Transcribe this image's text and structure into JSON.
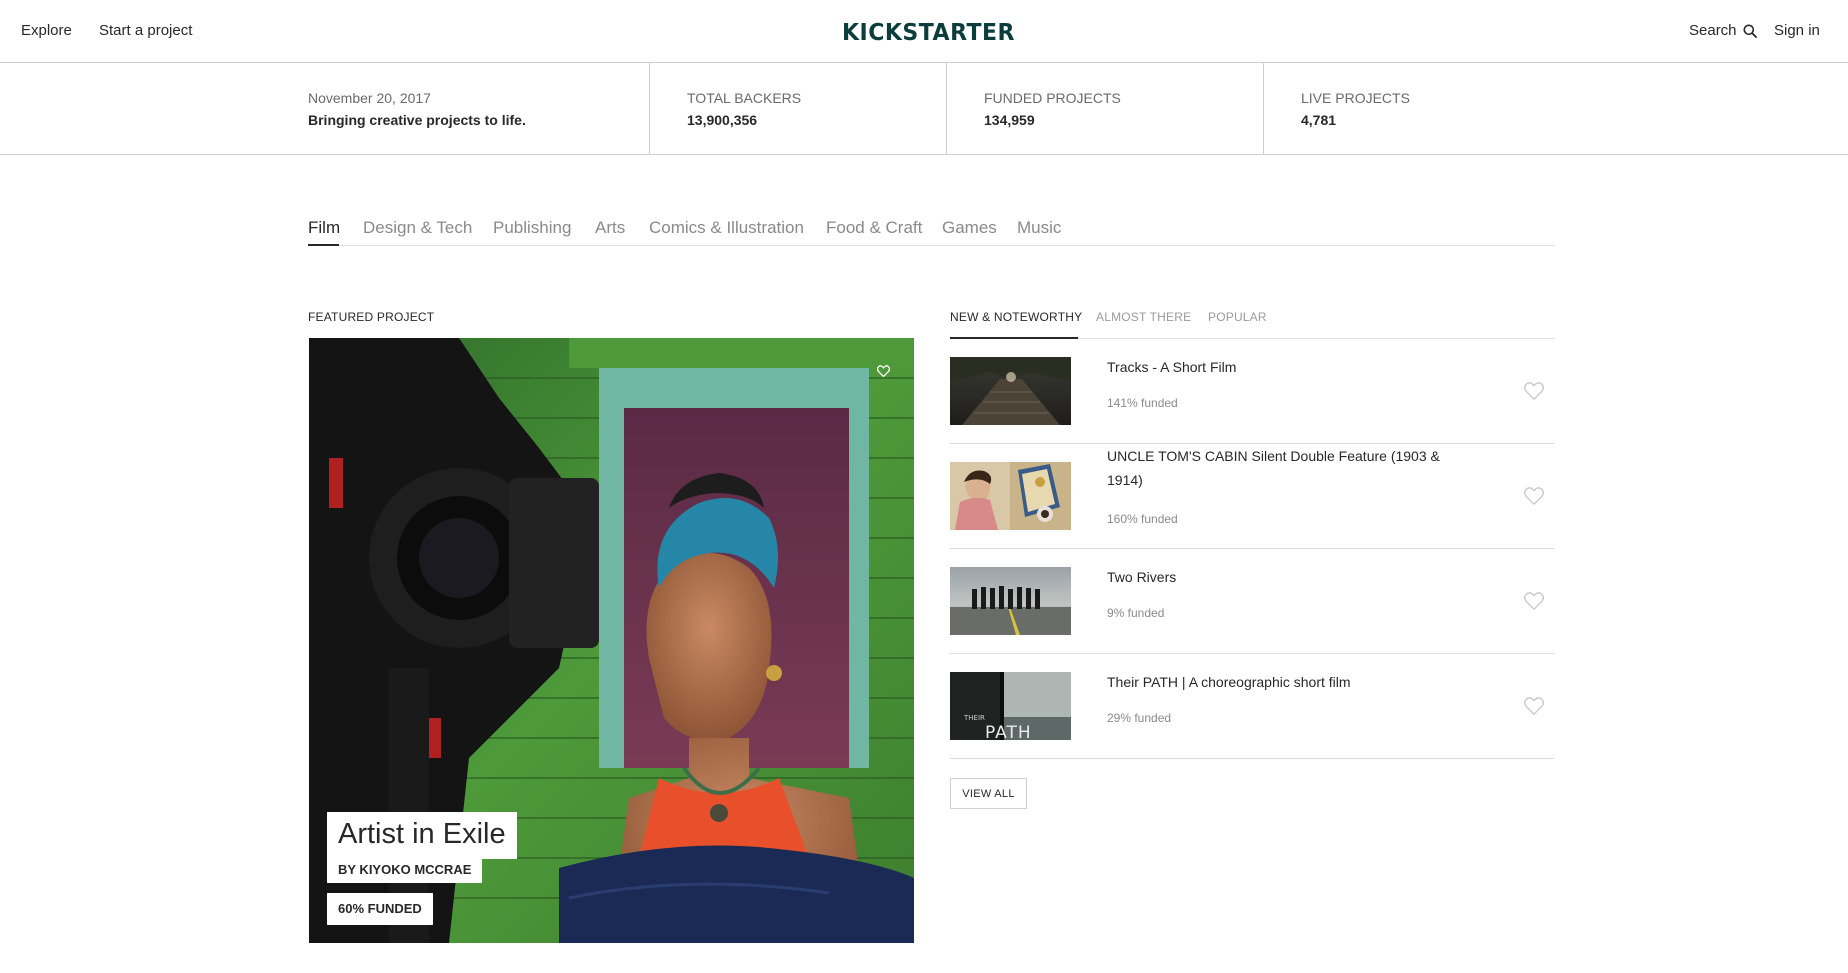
{
  "nav": {
    "explore": "Explore",
    "start_project": "Start a project",
    "logo_text": "KICKSTARTER",
    "search": "Search",
    "sign_in": "Sign in"
  },
  "stats": {
    "date": "November 20, 2017",
    "tagline": "Bringing creative projects to life.",
    "backers_label": "TOTAL BACKERS",
    "backers_value": "13,900,356",
    "funded_label": "FUNDED PROJECTS",
    "funded_value": "134,959",
    "live_label": "LIVE PROJECTS",
    "live_value": "4,781"
  },
  "categories": [
    "Film",
    "Design & Tech",
    "Publishing",
    "Arts",
    "Comics & Illustration",
    "Food & Craft",
    "Games",
    "Music"
  ],
  "featured": {
    "label": "FEATURED PROJECT",
    "title": "Artist in Exile",
    "by": "BY KIYOKO MCCRAE",
    "funded": "60% FUNDED"
  },
  "sort_tabs": [
    "NEW & NOTEWORTHY",
    "ALMOST THERE",
    "POPULAR"
  ],
  "projects": [
    {
      "title": "Tracks - A Short Film",
      "funded": "141% funded"
    },
    {
      "title": "UNCLE TOM'S CABIN Silent Double Feature (1903 & 1914)",
      "funded": "160% funded"
    },
    {
      "title": "Two Rivers",
      "funded": "9% funded"
    },
    {
      "title": "Their PATH | A choreographic short film",
      "funded": "29% funded"
    }
  ],
  "thumb_text": {
    "path_word": "PATH",
    "their_word": "THEIR"
  },
  "view_all": "VIEW ALL",
  "colors": {
    "brand": "#05ce78",
    "logo": "#0c3d3d",
    "text": "#282828"
  }
}
